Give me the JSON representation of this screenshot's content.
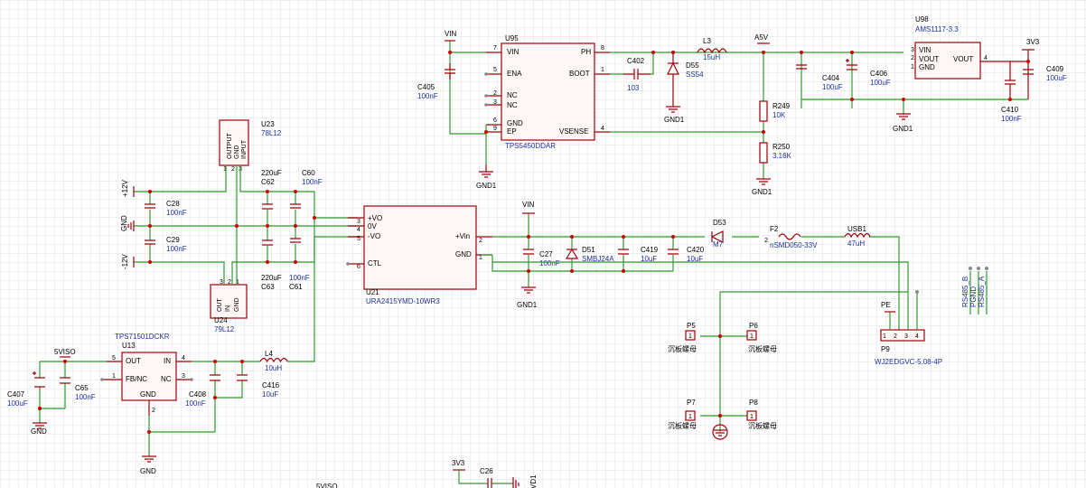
{
  "nets": {
    "vin": "VIN",
    "a5v": "A5V",
    "v3v3": "3V3",
    "v12p": "+12V",
    "gnd": "GND",
    "v12n": "-12V",
    "viso": "5VISO",
    "gnd1": "GND1",
    "pe": "PE",
    "rs485b": "RS485_B",
    "pgnd": "PGND",
    "rs485a": "RS485_A"
  },
  "ics": {
    "u95": {
      "ref": "U95",
      "val": "TPS5450DDAR",
      "pins": {
        "vin": "VIN",
        "ena": "ENA",
        "nc1": "NC",
        "nc2": "NC",
        "gnd": "GND",
        "ep": "EP",
        "ph": "PH",
        "boot": "BOOT",
        "vsense": "VSENSE"
      },
      "nums": [
        "7",
        "5",
        "2",
        "3",
        "6",
        "9",
        "8",
        "1",
        "4"
      ]
    },
    "u98": {
      "ref": "U98",
      "val": "AMS1117-3.3",
      "pins": {
        "vin": "VIN",
        "vout1": "VOUT",
        "gnd": "GND",
        "vout2": "VOUT"
      },
      "nums": [
        "3",
        "2",
        "1",
        "4"
      ]
    },
    "u23": {
      "ref": "U23",
      "val": "78L12",
      "pins": [
        "OUTPUT",
        "GND",
        "INPUT"
      ],
      "nums": [
        "1",
        "2",
        "3"
      ]
    },
    "u24": {
      "ref": "U24",
      "val": "79L12",
      "pins": [
        "OUT",
        "IN",
        "GND"
      ],
      "nums": [
        "3",
        "2",
        "1"
      ]
    },
    "u21": {
      "ref": "U21",
      "val": "URA2415YMD-10WR3",
      "pins": {
        "vop": "+VO",
        "v0": "0V",
        "von": "-VO",
        "ctl": "CTL",
        "vin": "+Vin",
        "gnd": "GND"
      },
      "nums": [
        "3",
        "4",
        "5",
        "6",
        "2",
        "1"
      ]
    },
    "u13": {
      "ref": "U13",
      "val": "TPS71501DCKR",
      "pins": {
        "out": "OUT",
        "fb": "FB/NC",
        "in": "IN",
        "nc": "NC",
        "gnd": "GND"
      },
      "nums": [
        "5",
        "1",
        "4",
        "3",
        "2"
      ]
    }
  },
  "parts": {
    "c405": {
      "ref": "C405",
      "val": "100nF"
    },
    "c402": {
      "ref": "C402",
      "val": "103"
    },
    "d55": {
      "ref": "D55",
      "val": "SS54"
    },
    "l3": {
      "ref": "L3",
      "val": "15uH"
    },
    "r249": {
      "ref": "R249",
      "val": "10K"
    },
    "r250": {
      "ref": "R250",
      "val": "3.16K"
    },
    "c404": {
      "ref": "C404",
      "val": "100uF"
    },
    "c406": {
      "ref": "C406",
      "val": "100uF"
    },
    "c410": {
      "ref": "C410",
      "val": "100nF"
    },
    "c409": {
      "ref": "C409",
      "val": "100uF"
    },
    "c62": {
      "ref": "C62",
      "val": "220uF"
    },
    "c60": {
      "ref": "C60",
      "val": "100nF"
    },
    "c28": {
      "ref": "C28",
      "val": "100nF"
    },
    "c29": {
      "ref": "C29",
      "val": "100nF"
    },
    "c63": {
      "ref": "C63",
      "val": "220uF"
    },
    "c61": {
      "ref": "C61",
      "val": "100nF"
    },
    "c27": {
      "ref": "C27",
      "val": "100nF"
    },
    "d51": {
      "ref": "D51",
      "val": "SMBJ24A"
    },
    "c419": {
      "ref": "C419",
      "val": "10uF"
    },
    "c420": {
      "ref": "C420",
      "val": "10uF"
    },
    "d53": {
      "ref": "D53",
      "val": "M7"
    },
    "f2": {
      "ref": "F2",
      "val": "nSMD050-33V"
    },
    "usb1": {
      "ref": "USB1",
      "val": "47uH"
    },
    "p9": {
      "ref": "P9",
      "val": "WJ2EDGVC-5.08-4P"
    },
    "p5": {
      "ref": "P5",
      "val": "沉板螺母"
    },
    "p6": {
      "ref": "P6",
      "val": "沉板螺母"
    },
    "p7": {
      "ref": "P7",
      "val": "沉板螺母"
    },
    "p8": {
      "ref": "P8",
      "val": "沉板螺母"
    },
    "c407": {
      "ref": "C407",
      "val": "100uF"
    },
    "c65": {
      "ref": "C65",
      "val": "100nF"
    },
    "c408": {
      "ref": "C408",
      "val": "100nF"
    },
    "c416": {
      "ref": "C416",
      "val": "10uF"
    },
    "l4": {
      "ref": "L4",
      "val": "10uH"
    },
    "c26": {
      "ref": "C26"
    }
  },
  "pin_numbers": {
    "f2_pin": "2",
    "p9_pins": [
      "1",
      "2",
      "3",
      "4"
    ],
    "p_conn": "1",
    "d53_pin": "2"
  },
  "cut_text": "VD1"
}
